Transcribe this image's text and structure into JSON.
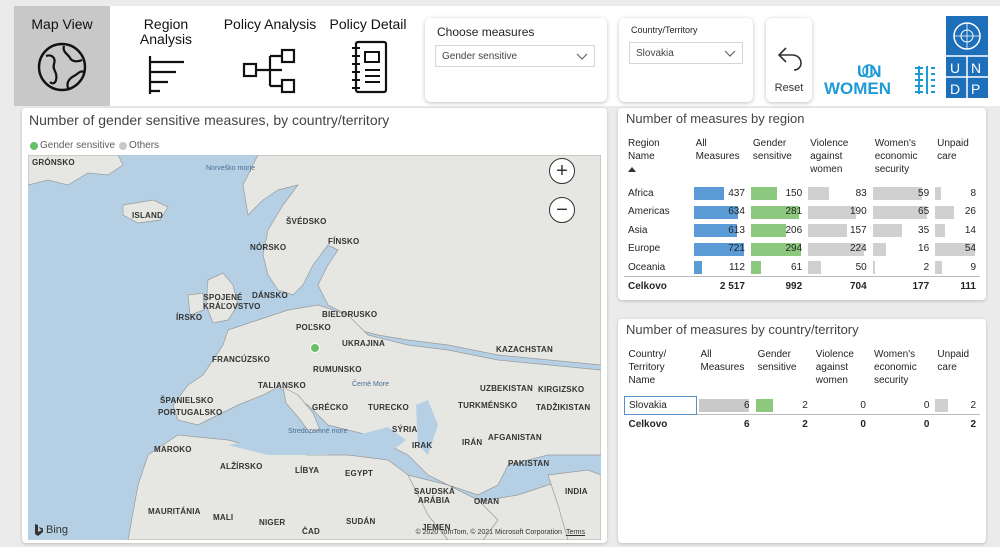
{
  "nav": {
    "map_view": "Map View",
    "region_analysis": "Region\nAnalysis",
    "policy_analysis": "Policy Analysis",
    "policy_detail": "Policy Detail"
  },
  "filters": {
    "measures_title": "Choose measures",
    "measures_value": "Gender sensitive",
    "country_title": "Country/Territory",
    "country_value": "Slovakia",
    "reset_label": "Reset"
  },
  "logos": {
    "unwomen": "UN WOMEN",
    "undp": "UNDP"
  },
  "map": {
    "title": "Number of gender sensitive measures, by country/territory",
    "legend": [
      {
        "label": "Gender sensitive",
        "color": "#6abf69"
      },
      {
        "label": "Others",
        "color": "#c8c8c8"
      }
    ],
    "labels": [
      "GRÓNSKO",
      "ISLAND",
      "ŠVÉDSKO",
      "FÍNSKO",
      "NÓRSKO",
      "DÁNSKO",
      "SPOJENÉ KRÁĽOVSTVO",
      "ÍRSKO",
      "BIELORUSKO",
      "POĽSKO",
      "UKRAJINA",
      "FRANCÚZSKO",
      "RUMUNSKO",
      "TALIANSKO",
      "KAZACHSTAN",
      "UZBEKISTAN",
      "KIRGIZSKO",
      "ŠPANIELSKO",
      "PORTUGALSKO",
      "GRÉCKO",
      "TURECKO",
      "TURKMÉNSKO",
      "TADŽIKISTAN",
      "SÝRIA",
      "AFGANISTAN",
      "IRAK",
      "IRÁN",
      "MAROKO",
      "ALŽÍRSKO",
      "LÍBYA",
      "EGYPT",
      "PAKISTAN",
      "SAUDSKÁ ARÁBIA",
      "OMAN",
      "INDIA",
      "MAURITÁNIA",
      "MALI",
      "NIGER",
      "ČAD",
      "SUDÁN",
      "JEMEN"
    ],
    "seas": [
      "Norveško morje",
      "Černé More",
      "Stredozemné more"
    ],
    "bing": "Bing",
    "copyright": "© 2020 TomTom, © 2021 Microsoft Corporation",
    "terms": "Terms"
  },
  "region_table": {
    "title": "Number of measures by region",
    "headers": [
      "Region\nName",
      "All\nMeasures",
      "Gender\nsensitive",
      "Violence\nagainst\nwomen",
      "Women's\neconomic\nsecurity",
      "Unpaid\ncare"
    ],
    "rows": [
      {
        "name": "Africa",
        "all": 437,
        "gender": 150,
        "violence": 83,
        "economic": 59,
        "unpaid": 8
      },
      {
        "name": "Americas",
        "all": 634,
        "gender": 281,
        "violence": 190,
        "economic": 65,
        "unpaid": 26
      },
      {
        "name": "Asia",
        "all": 613,
        "gender": 206,
        "violence": 157,
        "economic": 35,
        "unpaid": 14
      },
      {
        "name": "Europe",
        "all": 721,
        "gender": 294,
        "violence": 224,
        "economic": 16,
        "unpaid": 54
      },
      {
        "name": "Oceania",
        "all": 112,
        "gender": 61,
        "violence": 50,
        "economic": 2,
        "unpaid": 9
      }
    ],
    "total": {
      "name": "Celkovo",
      "all": "2 517",
      "gender": "992",
      "violence": "704",
      "economic": "177",
      "unpaid": "111"
    }
  },
  "country_table": {
    "title": "Number of measures by country/territory",
    "headers": [
      "Country/\nTerritory\nName",
      "All\nMeasures",
      "Gender\nsensitive",
      "Violence\nagainst\nwomen",
      "Women's\neconomic\nsecurity",
      "Unpaid\ncare"
    ],
    "rows": [
      {
        "name": "Slovakia",
        "all": 6,
        "gender": 2,
        "violence": 0,
        "economic": 0,
        "unpaid": 2
      }
    ],
    "total": {
      "name": "Celkovo",
      "all": "6",
      "gender": "2",
      "violence": "0",
      "economic": "0",
      "unpaid": "2"
    }
  },
  "colors": {
    "bar_all": "#5b9bd5",
    "bar_all_light": "#c9c9c9",
    "bar_gender": "#8cc97e",
    "bar_other": "#d0d0d0"
  }
}
